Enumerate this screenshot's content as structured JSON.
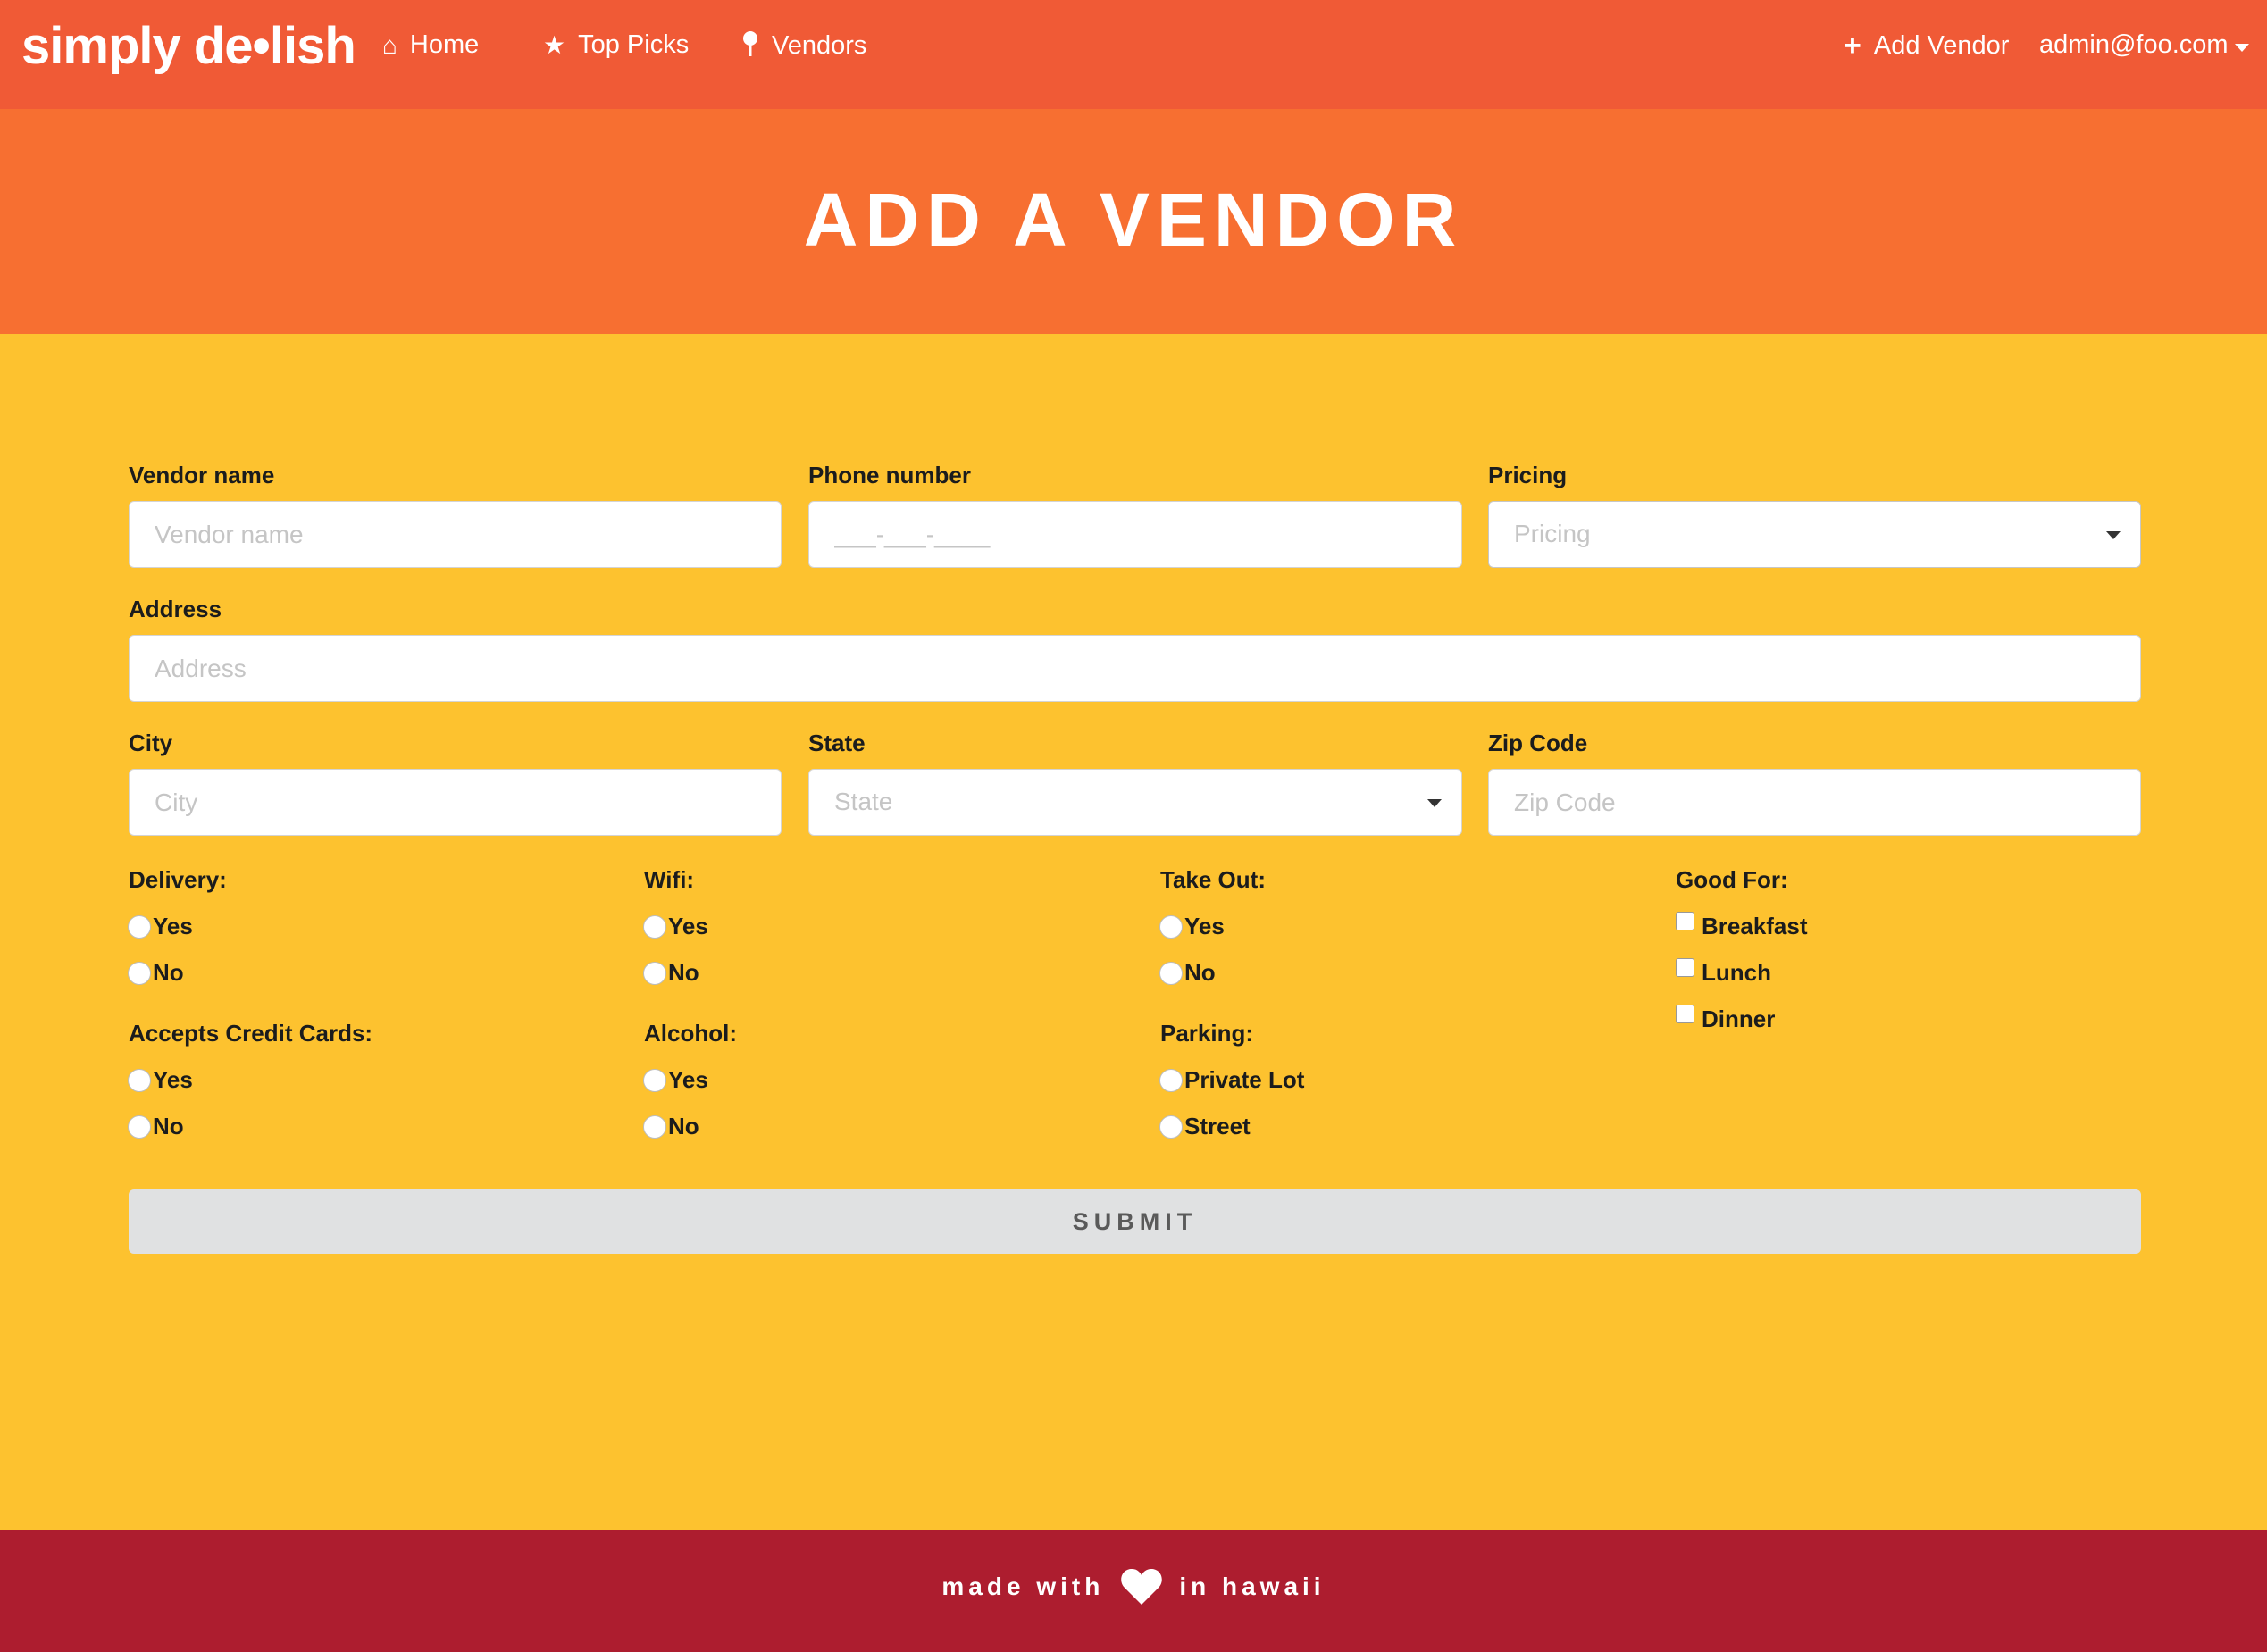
{
  "navbar": {
    "brand": "simply de•lish",
    "items": [
      {
        "label": "Home",
        "icon": "home-icon"
      },
      {
        "label": "Top Picks",
        "icon": "star-icon"
      },
      {
        "label": "Vendors",
        "icon": "map-pin-icon"
      }
    ],
    "add_vendor": "Add Vendor",
    "user_email": "admin@foo.com"
  },
  "hero": {
    "title": "ADD A VENDOR"
  },
  "form": {
    "vendor_name": {
      "label": "Vendor name",
      "placeholder": "Vendor name"
    },
    "phone": {
      "label": "Phone number",
      "placeholder": "___-___-____"
    },
    "pricing": {
      "label": "Pricing",
      "placeholder": "Pricing"
    },
    "address": {
      "label": "Address",
      "placeholder": "Address"
    },
    "city": {
      "label": "City",
      "placeholder": "City"
    },
    "state": {
      "label": "State",
      "placeholder": "State"
    },
    "zip": {
      "label": "Zip Code",
      "placeholder": "Zip Code"
    },
    "delivery": {
      "label": "Delivery:",
      "options": [
        "Yes",
        "No"
      ]
    },
    "wifi": {
      "label": "Wifi:",
      "options": [
        "Yes",
        "No"
      ]
    },
    "takeout": {
      "label": "Take Out:",
      "options": [
        "Yes",
        "No"
      ]
    },
    "good_for": {
      "label": "Good For:",
      "options": [
        "Breakfast",
        "Lunch",
        "Dinner"
      ]
    },
    "credit_cards": {
      "label": "Accepts Credit Cards:",
      "options": [
        "Yes",
        "No"
      ]
    },
    "alcohol": {
      "label": "Alcohol:",
      "options": [
        "Yes",
        "No"
      ]
    },
    "parking": {
      "label": "Parking:",
      "options": [
        "Private Lot",
        "Street"
      ]
    },
    "submit_label": "SUBMIT"
  },
  "footer": {
    "before": "made with",
    "after": "in hawaii",
    "icon": "heart-icon"
  },
  "colors": {
    "navbar": "#f05a36",
    "hero": "#f76f31",
    "page": "#fdc22f",
    "footer": "#ad1d2f",
    "submit": "#e0e1e2"
  }
}
